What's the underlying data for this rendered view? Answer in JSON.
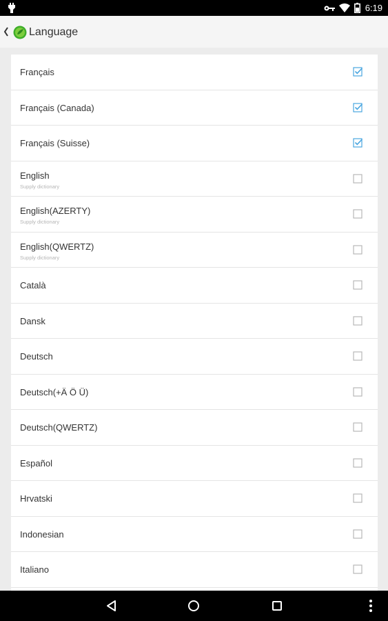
{
  "status_bar": {
    "time": "6:19",
    "icons": [
      "notification-icon",
      "key-icon",
      "wifi-icon",
      "battery-icon"
    ]
  },
  "app_bar": {
    "title": "Language",
    "back_icon": "back-icon",
    "logo_icon": "app-logo-icon"
  },
  "languages": [
    {
      "name": "Français",
      "sub": "",
      "checked": true
    },
    {
      "name": "Français (Canada)",
      "sub": "",
      "checked": true
    },
    {
      "name": "Français (Suisse)",
      "sub": "",
      "checked": true
    },
    {
      "name": "English",
      "sub": "Supply dictionary",
      "checked": false
    },
    {
      "name": "English(AZERTY)",
      "sub": "Supply dictionary",
      "checked": false
    },
    {
      "name": "English(QWERTZ)",
      "sub": "Supply dictionary",
      "checked": false
    },
    {
      "name": "Català",
      "sub": "",
      "checked": false
    },
    {
      "name": "Dansk",
      "sub": "",
      "checked": false
    },
    {
      "name": "Deutsch",
      "sub": "",
      "checked": false
    },
    {
      "name": "Deutsch(+Ä Ö Ü)",
      "sub": "",
      "checked": false
    },
    {
      "name": "Deutsch(QWERTZ)",
      "sub": "",
      "checked": false
    },
    {
      "name": "Español",
      "sub": "",
      "checked": false
    },
    {
      "name": "Hrvatski",
      "sub": "",
      "checked": false
    },
    {
      "name": "Indonesian",
      "sub": "",
      "checked": false
    },
    {
      "name": "Italiano",
      "sub": "",
      "checked": false
    }
  ],
  "colors": {
    "checked": "#4aa6e0",
    "unchecked": "#b8b8b8"
  },
  "nav_bar": {
    "icons": [
      "back-triangle-icon",
      "home-circle-icon",
      "recents-square-icon",
      "overflow-menu-icon"
    ]
  }
}
